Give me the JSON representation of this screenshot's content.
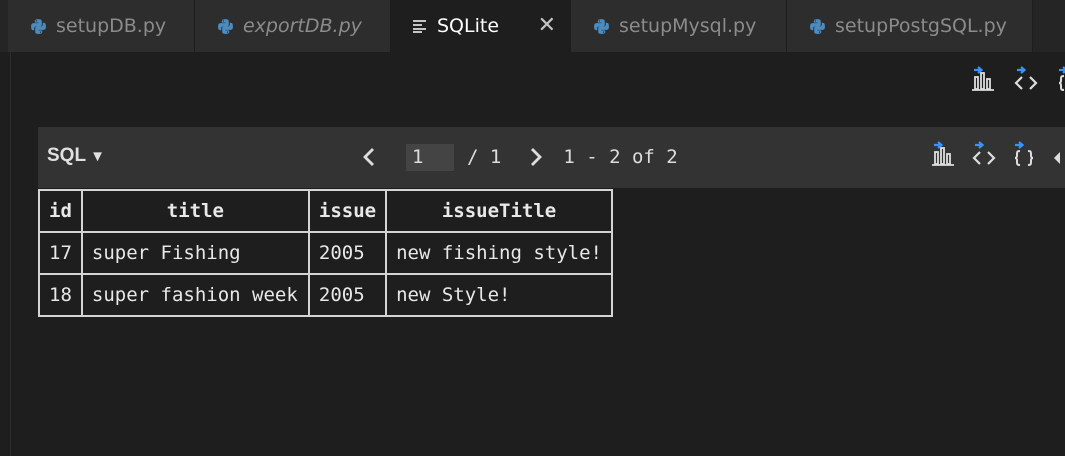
{
  "tabs": [
    {
      "label": "setupDB.py",
      "icon": "python-icon",
      "italic": false
    },
    {
      "label": "exportDB.py",
      "icon": "python-icon",
      "italic": true
    },
    {
      "label": "SQLite",
      "icon": "preview-lines-icon",
      "italic": false,
      "active": true
    },
    {
      "label": "setupMysql.py",
      "icon": "python-icon",
      "italic": false
    },
    {
      "label": "setupPostgSQL.py",
      "icon": "python-icon",
      "italic": false
    }
  ],
  "tab_close_glyph": "✕",
  "panel": {
    "mode_label": "SQL",
    "mode_caret": "▼",
    "page_current": "1",
    "page_total": "/ 1",
    "range": "1 - 2 of 2"
  },
  "table": {
    "columns": [
      "id",
      "title",
      "issue",
      "issueTitle"
    ],
    "rows": [
      [
        "17",
        "super Fishing",
        "2005",
        "new fishing style!"
      ],
      [
        "18",
        "super fashion week",
        "2005",
        "new Style!"
      ]
    ]
  },
  "colors": {
    "accent_blue": "#3794ff",
    "python_blue": "#4b8bbe",
    "background": "#1e1e1e",
    "tabbar": "#252526"
  }
}
